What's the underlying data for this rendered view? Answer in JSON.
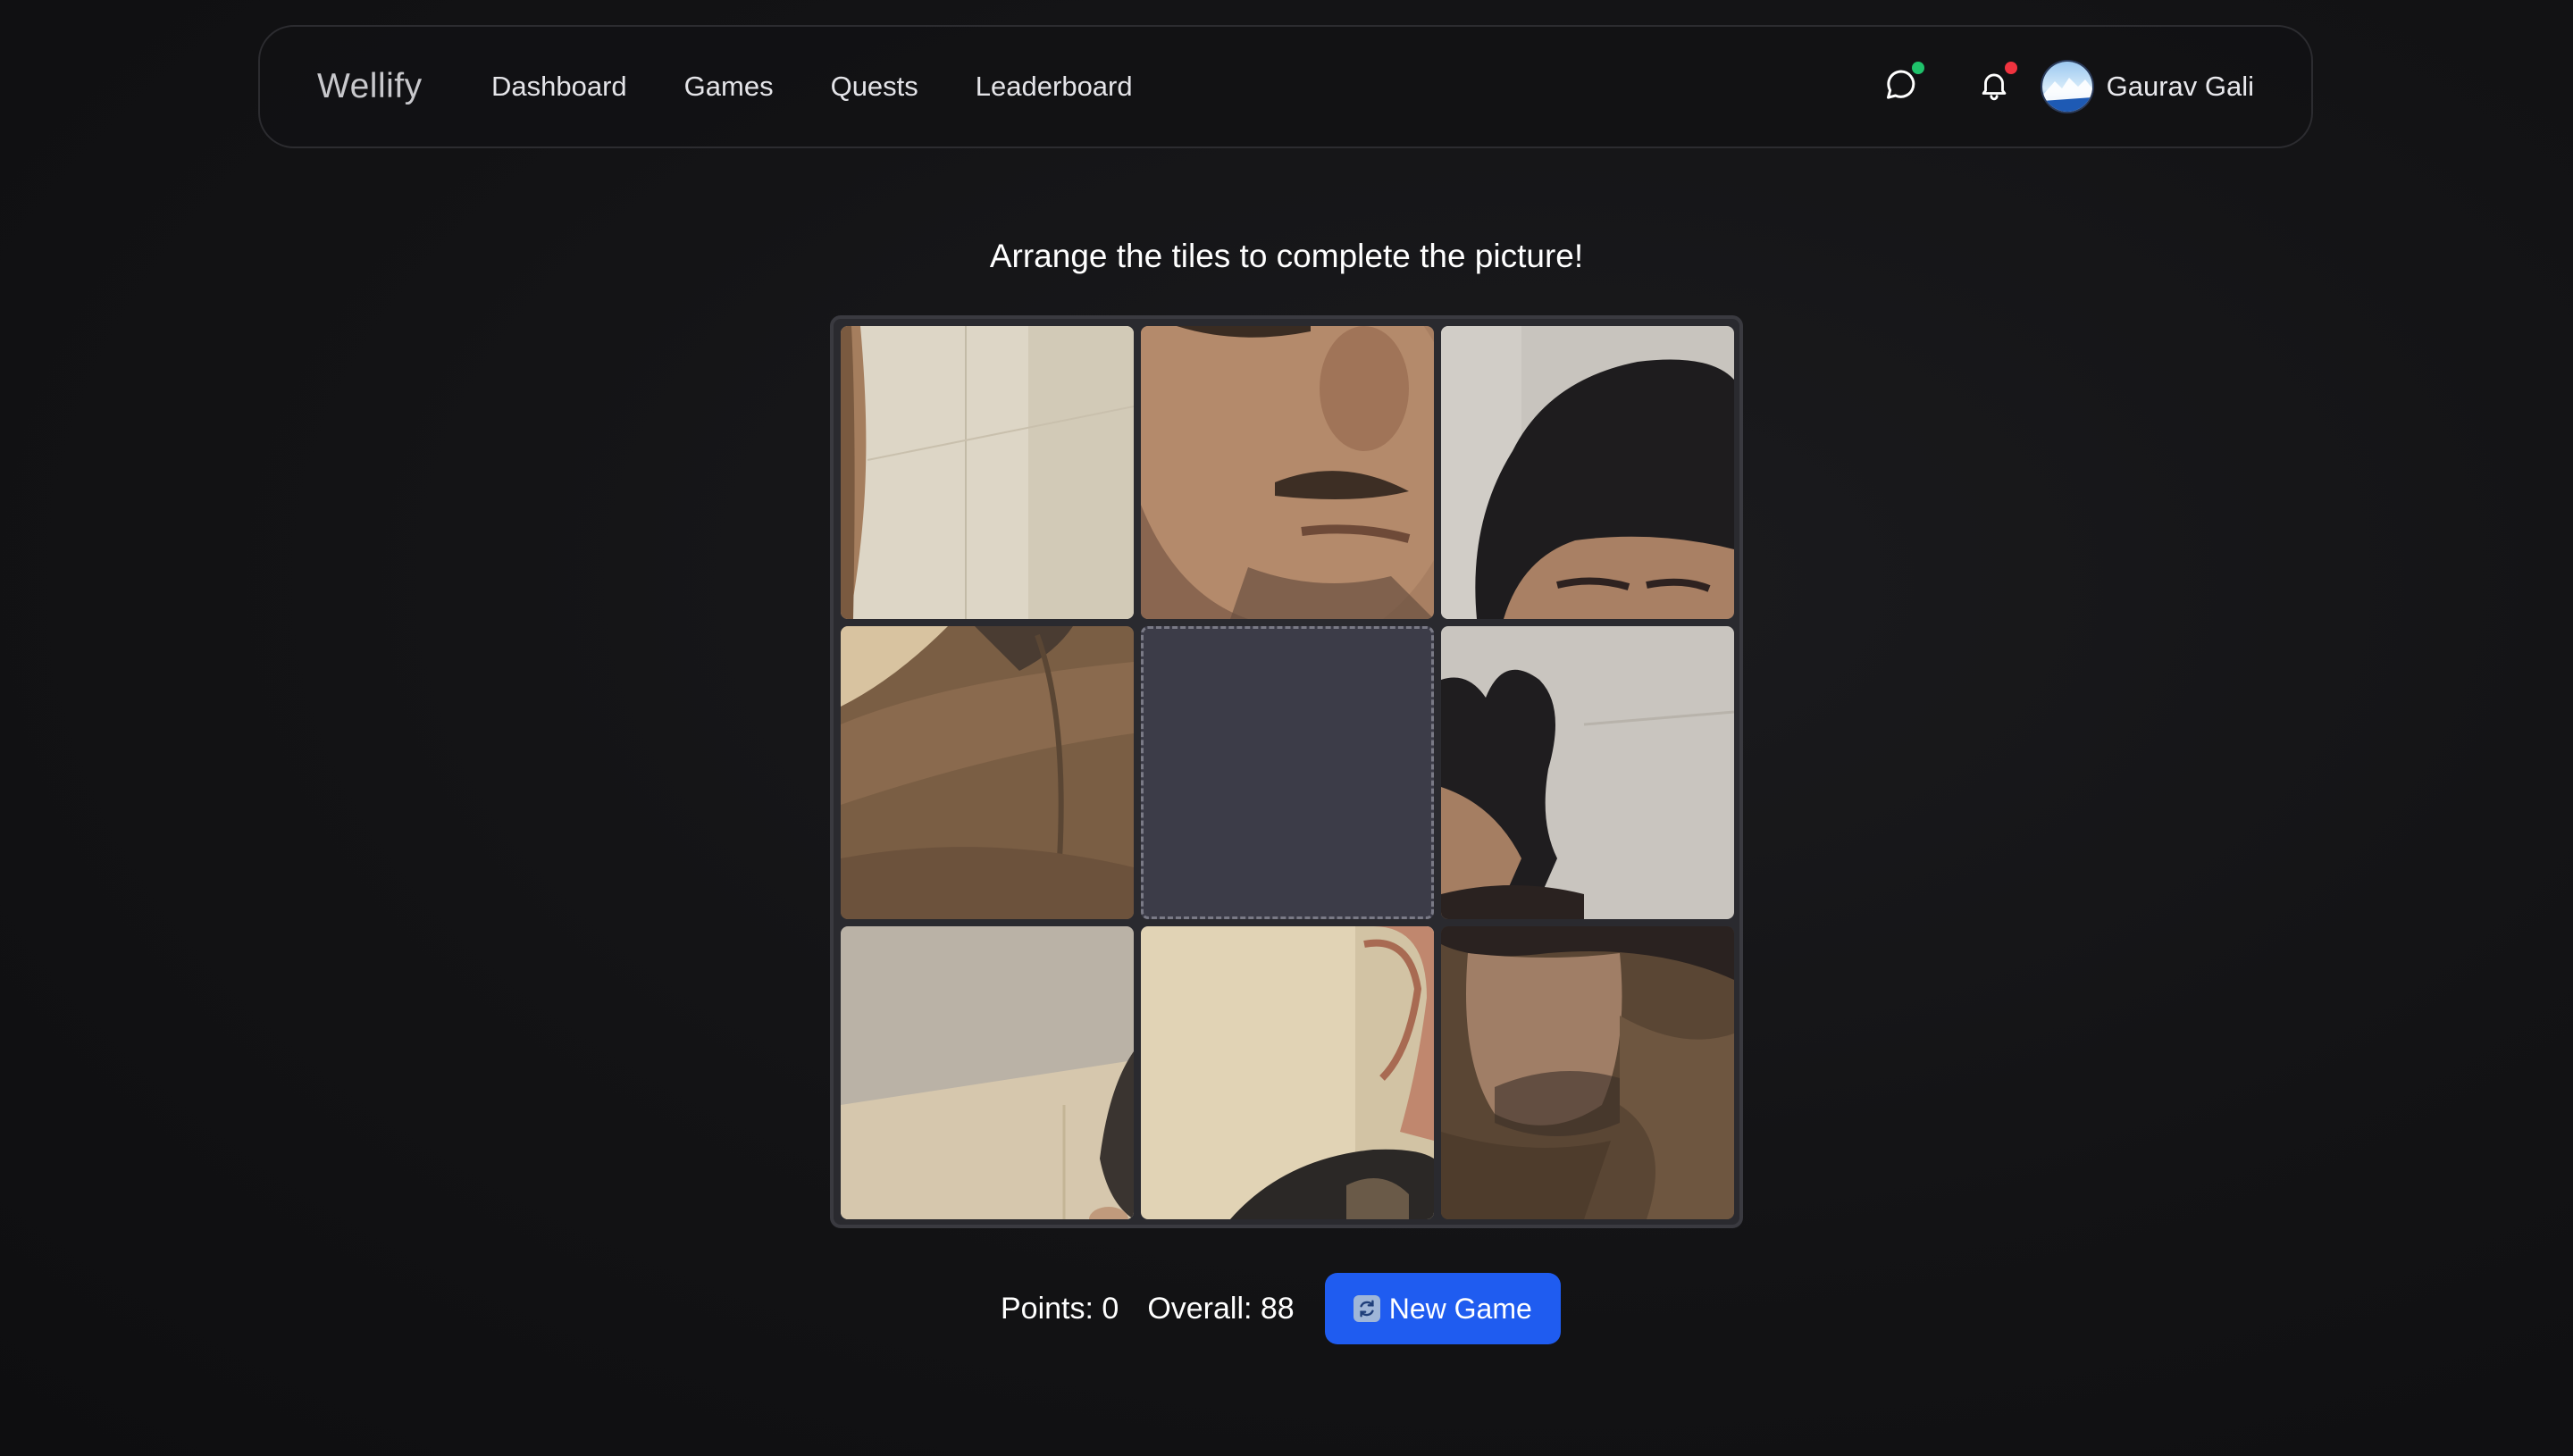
{
  "navbar": {
    "brand": "Wellify",
    "links": [
      {
        "label": "Dashboard"
      },
      {
        "label": "Games"
      },
      {
        "label": "Quests"
      },
      {
        "label": "Leaderboard"
      }
    ],
    "chat_icon": "chat-bubble-icon",
    "chat_indicator_color": "#1fc26b",
    "bell_icon": "bell-icon",
    "bell_indicator_color": "#f0333f",
    "user_name": "Gaurav Gali"
  },
  "game": {
    "instruction": "Arrange the tiles to complete the picture!",
    "grid_size": 3,
    "empty_tile": "center",
    "points_text": "Points: 0",
    "overall_text": "Overall: 88",
    "new_game_label": "New Game",
    "new_game_icon": "refresh-icon",
    "accent_color": "#1f5cf0"
  }
}
